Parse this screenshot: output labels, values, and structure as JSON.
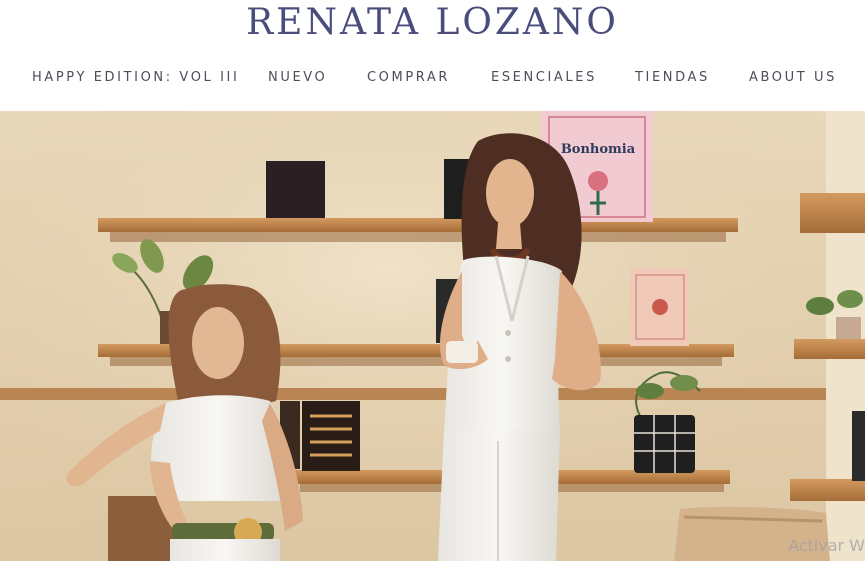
{
  "brand": {
    "name": "RENATA LOZANO"
  },
  "nav": {
    "items": [
      {
        "label": "HAPPY EDITION: VOL III"
      },
      {
        "label": "NUEVO"
      },
      {
        "label": "COMPRAR"
      },
      {
        "label": "ESENCIALES"
      },
      {
        "label": "TIENDAS"
      },
      {
        "label": "ABOUT US"
      }
    ]
  },
  "hero": {
    "book_title": "Bonhomia",
    "windows_watermark": "Activar W"
  },
  "colors": {
    "brand": "#4a4d7c",
    "nav_text": "#4d4d5a",
    "wall": "#e4d1b0",
    "shelf": "#c68d52"
  }
}
